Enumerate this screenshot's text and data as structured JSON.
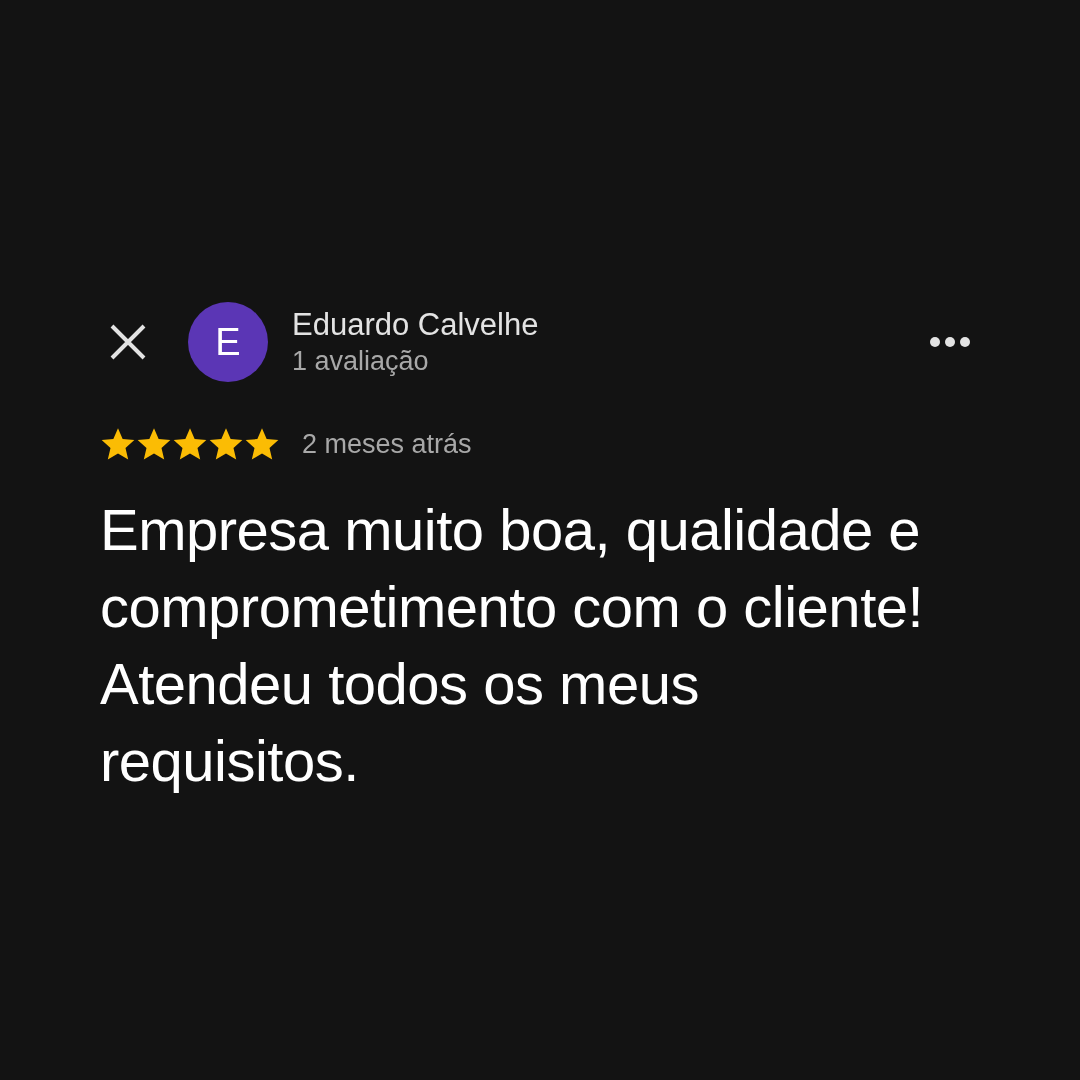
{
  "review": {
    "author": {
      "initial": "E",
      "name": "Eduardo Calvelhe",
      "subtitle": "1 avaliação"
    },
    "stars": 5,
    "time": "2 meses atrás",
    "text": "Empresa muito boa, qualidade e comprometimento com o cliente! Atendeu todos os meus requisitos."
  }
}
